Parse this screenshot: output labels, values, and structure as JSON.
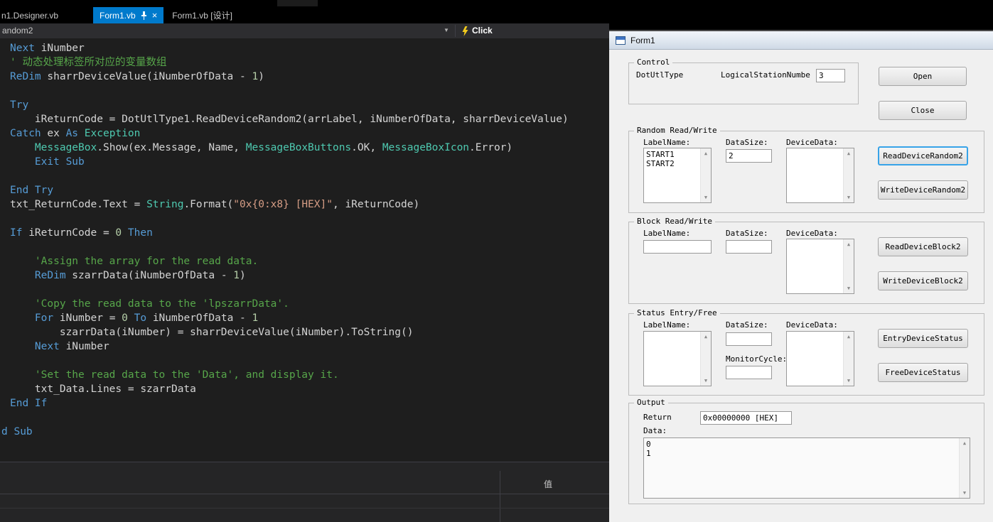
{
  "vs": {
    "tabs": [
      {
        "label": "n1.Designer.vb",
        "state": "inactive"
      },
      {
        "label": "Form1.vb",
        "state": "active"
      },
      {
        "label": "Form1.vb [设计]",
        "state": "inactive"
      }
    ],
    "navbar": {
      "member_dropdown": "andom2",
      "event_dropdown": "Click"
    },
    "code": {
      "lines": [
        {
          "tokens": [
            {
              "t": "Next",
              "c": "kw"
            },
            {
              "t": " iNumber",
              "c": "id"
            }
          ]
        },
        {
          "tokens": [
            {
              "t": "' 动态处理标签所对应的变量数组",
              "c": "cm"
            }
          ]
        },
        {
          "tokens": [
            {
              "t": "ReDim",
              "c": "kw"
            },
            {
              "t": " sharrDeviceValue(iNumberOfData - ",
              "c": "id"
            },
            {
              "t": "1",
              "c": "nu"
            },
            {
              "t": ")",
              "c": "id"
            }
          ]
        },
        {
          "tokens": []
        },
        {
          "tokens": [
            {
              "t": "Try",
              "c": "kw"
            }
          ]
        },
        {
          "tokens": [
            {
              "t": "    iReturnCode = DotUtlType1.ReadDeviceRandom2(arrLabel, iNumberOfData, sharrDeviceValue)",
              "c": "id"
            }
          ]
        },
        {
          "tokens": [
            {
              "t": "Catch",
              "c": "kw"
            },
            {
              "t": " ex ",
              "c": "id"
            },
            {
              "t": "As",
              "c": "kw"
            },
            {
              "t": " ",
              "c": "id"
            },
            {
              "t": "Exception",
              "c": "ty"
            }
          ]
        },
        {
          "tokens": [
            {
              "t": "    ",
              "c": "id"
            },
            {
              "t": "MessageBox",
              "c": "ty"
            },
            {
              "t": ".Show(ex.Message, Name, ",
              "c": "id"
            },
            {
              "t": "MessageBoxButtons",
              "c": "ty"
            },
            {
              "t": ".OK, ",
              "c": "id"
            },
            {
              "t": "MessageBoxIcon",
              "c": "ty"
            },
            {
              "t": ".Error)",
              "c": "id"
            }
          ]
        },
        {
          "tokens": [
            {
              "t": "    ",
              "c": "id"
            },
            {
              "t": "Exit Sub",
              "c": "kw"
            }
          ]
        },
        {
          "tokens": []
        },
        {
          "tokens": [
            {
              "t": "End Try",
              "c": "kw"
            }
          ]
        },
        {
          "tokens": [
            {
              "t": "txt_ReturnCode.Text = ",
              "c": "id"
            },
            {
              "t": "String",
              "c": "ty"
            },
            {
              "t": ".Format(",
              "c": "id"
            },
            {
              "t": "\"0x{0:x8} [HEX]\"",
              "c": "st"
            },
            {
              "t": ", iReturnCode)",
              "c": "id"
            }
          ]
        },
        {
          "tokens": []
        },
        {
          "tokens": [
            {
              "t": "If",
              "c": "kw"
            },
            {
              "t": " iReturnCode = ",
              "c": "id"
            },
            {
              "t": "0",
              "c": "nu"
            },
            {
              "t": " ",
              "c": "id"
            },
            {
              "t": "Then",
              "c": "kw"
            }
          ]
        },
        {
          "tokens": []
        },
        {
          "tokens": [
            {
              "t": "    'Assign the array for the read data.",
              "c": "cm"
            }
          ]
        },
        {
          "tokens": [
            {
              "t": "    ",
              "c": "id"
            },
            {
              "t": "ReDim",
              "c": "kw"
            },
            {
              "t": " szarrData(iNumberOfData - ",
              "c": "id"
            },
            {
              "t": "1",
              "c": "nu"
            },
            {
              "t": ")",
              "c": "id"
            }
          ]
        },
        {
          "tokens": []
        },
        {
          "tokens": [
            {
              "t": "    'Copy the read data to the 'lpszarrData'.",
              "c": "cm"
            }
          ]
        },
        {
          "tokens": [
            {
              "t": "    ",
              "c": "id"
            },
            {
              "t": "For",
              "c": "kw"
            },
            {
              "t": " iNumber = ",
              "c": "id"
            },
            {
              "t": "0",
              "c": "nu"
            },
            {
              "t": " ",
              "c": "id"
            },
            {
              "t": "To",
              "c": "kw"
            },
            {
              "t": " iNumberOfData - ",
              "c": "id"
            },
            {
              "t": "1",
              "c": "nu"
            }
          ]
        },
        {
          "tokens": [
            {
              "t": "        szarrData(iNumber) = sharrDeviceValue(iNumber).ToString()",
              "c": "id"
            }
          ]
        },
        {
          "tokens": [
            {
              "t": "    ",
              "c": "id"
            },
            {
              "t": "Next",
              "c": "kw"
            },
            {
              "t": " iNumber",
              "c": "id"
            }
          ]
        },
        {
          "tokens": []
        },
        {
          "tokens": [
            {
              "t": "    'Set the read data to the 'Data', and display it.",
              "c": "cm"
            }
          ]
        },
        {
          "tokens": [
            {
              "t": "    txt_Data.Lines = szarrData",
              "c": "id"
            }
          ]
        },
        {
          "tokens": [
            {
              "t": "End If",
              "c": "kw"
            }
          ]
        },
        {
          "tokens": []
        },
        {
          "cut": true,
          "tokens": [
            {
              "t": "d Sub",
              "c": "kw"
            }
          ]
        }
      ]
    },
    "watch_panel": {
      "value_column_header": "值"
    }
  },
  "icons": {
    "close": "×",
    "chevron_down": "▼",
    "scroll_up": "▲",
    "scroll_down": "▼"
  },
  "form": {
    "title": "Form1",
    "control_group": {
      "label": "Control",
      "dotutltype_label": "DotUtlType",
      "logical_station_label": "LogicalStationNumbe",
      "logical_station_value": "3"
    },
    "open_button": "Open",
    "close_button": "Close",
    "random_group": {
      "label": "Random Read/Write",
      "labelname_label": "LabelName:",
      "datasize_label": "DataSize:",
      "devicedata_label": "DeviceData:",
      "labelname_value": "START1\nSTART2",
      "datasize_value": "2",
      "devicedata_value": "",
      "read_button": "ReadDeviceRandom2",
      "write_button": "WriteDeviceRandom2"
    },
    "block_group": {
      "label": "Block Read/Write",
      "labelname_label": "LabelName:",
      "datasize_label": "DataSize:",
      "devicedata_label": "DeviceData:",
      "labelname_value": "",
      "datasize_value": "",
      "devicedata_value": "",
      "read_button": "ReadDeviceBlock2",
      "write_button": "WriteDeviceBlock2"
    },
    "status_group": {
      "label": "Status Entry/Free",
      "labelname_label": "LabelName:",
      "datasize_label": "DataSize:",
      "monitorcycle_label": "MonitorCycle:",
      "devicedata_label": "DeviceData:",
      "labelname_value": "",
      "datasize_value": "",
      "monitorcycle_value": "",
      "devicedata_value": "",
      "entry_button": "EntryDeviceStatus",
      "free_button": "FreeDeviceStatus"
    },
    "output_group": {
      "label": "Output",
      "return_label": "Return",
      "return_value": "0x00000000 [HEX]",
      "data_label": "Data:",
      "data_value": "0\n1"
    }
  }
}
